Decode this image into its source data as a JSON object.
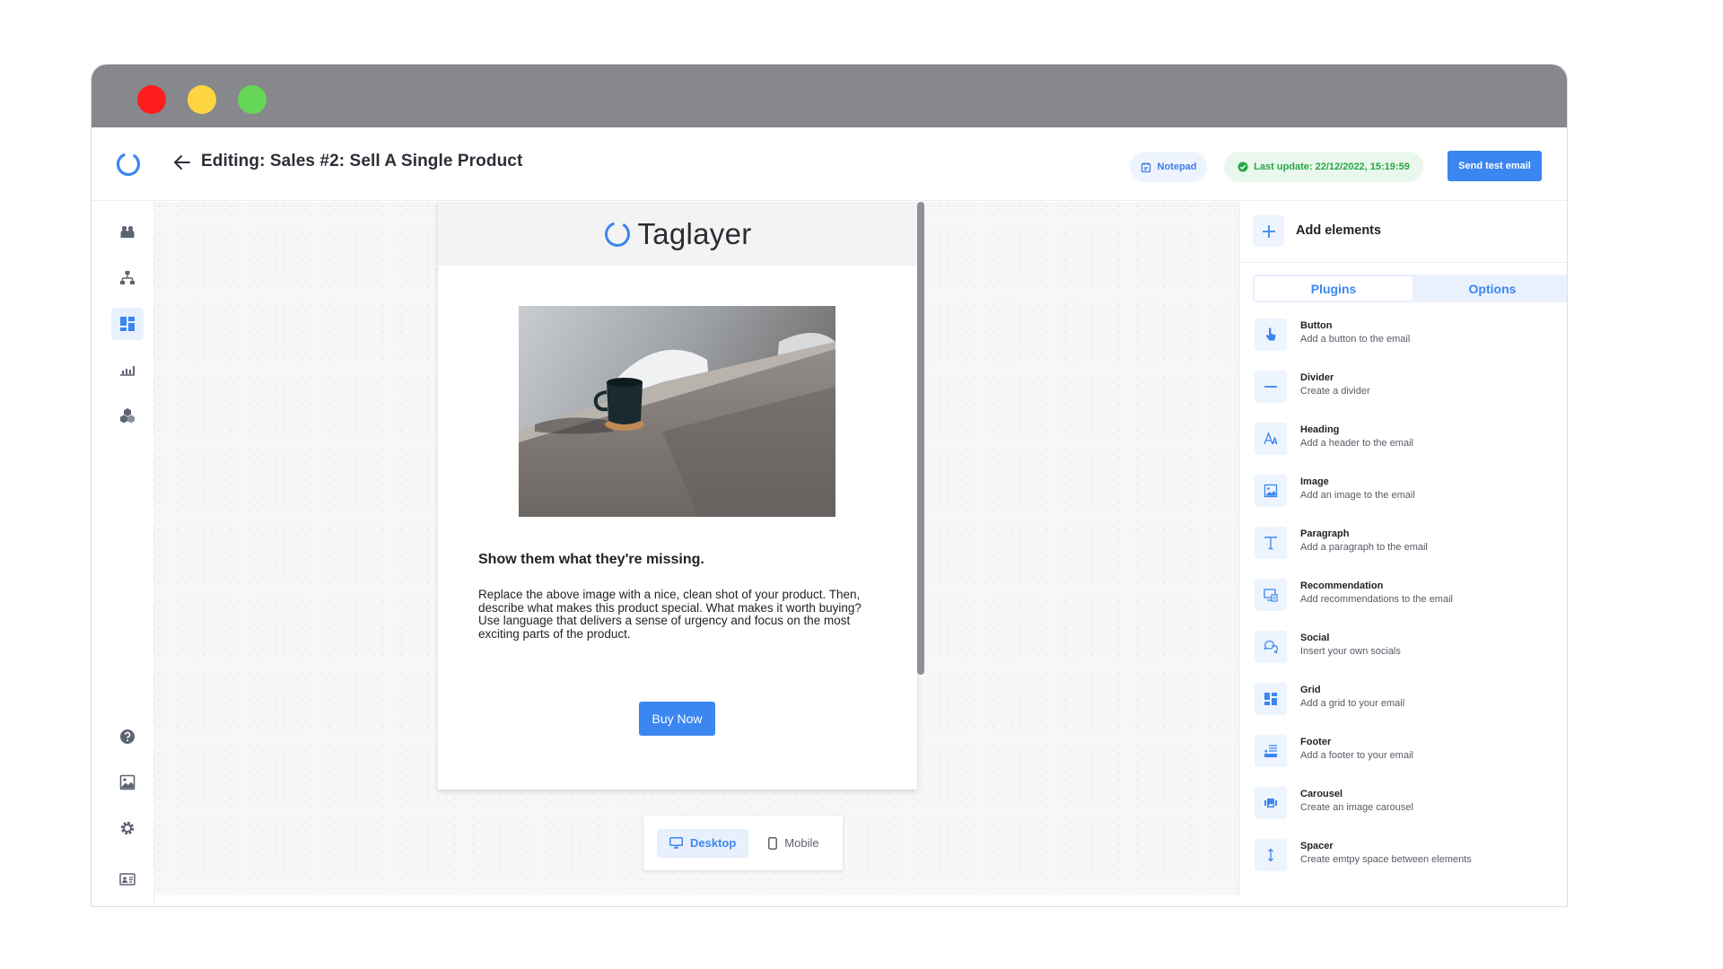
{
  "header": {
    "title": "Editing: Sales #2: Sell A Single Product",
    "notepad_label": "Notepad",
    "last_update_label": "Last update: 22/12/2022, 15:19:59",
    "send_test_label": "Send test email"
  },
  "sidebar": {
    "items": [
      {
        "name": "contacts-icon"
      },
      {
        "name": "segments-icon"
      },
      {
        "name": "templates-icon",
        "active": true
      },
      {
        "name": "analytics-icon"
      },
      {
        "name": "integrations-icon"
      },
      {
        "name": "help-icon"
      },
      {
        "name": "image-library-icon"
      },
      {
        "name": "settings-icon"
      },
      {
        "name": "account-icon"
      }
    ]
  },
  "email": {
    "brand": "Taglayer",
    "heading": "Show them what they're missing.",
    "paragraph": "Replace the above image with a nice, clean shot of your product. Then, describe what makes this product special. What makes it worth buying? Use language that delivers a sense of urgency and focus on the most exciting parts of the product.",
    "cta_label": "Buy Now"
  },
  "device_toggle": {
    "desktop_label": "Desktop",
    "mobile_label": "Mobile",
    "selected": "Desktop"
  },
  "panel": {
    "title": "Add elements",
    "tabs": [
      {
        "label": "Plugins",
        "active": true
      },
      {
        "label": "Options",
        "active": false
      }
    ],
    "plugins": [
      {
        "name": "Button",
        "description": "Add a button to the email",
        "icon": "pointer-icon"
      },
      {
        "name": "Divider",
        "description": "Create a divider",
        "icon": "minus-icon"
      },
      {
        "name": "Heading",
        "description": "Add a header to the email",
        "icon": "heading-icon"
      },
      {
        "name": "Image",
        "description": "Add an image to the email",
        "icon": "image-icon"
      },
      {
        "name": "Paragraph",
        "description": "Add a paragraph to the email",
        "icon": "text-icon"
      },
      {
        "name": "Recommendation",
        "description": "Add recommendations to the email",
        "icon": "recommendation-icon"
      },
      {
        "name": "Social",
        "description": "Insert your own socials",
        "icon": "chat-icon"
      },
      {
        "name": "Grid",
        "description": "Add a grid to your email",
        "icon": "grid-icon"
      },
      {
        "name": "Footer",
        "description": "Add a footer to your email",
        "icon": "footer-icon"
      },
      {
        "name": "Carousel",
        "description": "Create an image carousel",
        "icon": "carousel-icon"
      },
      {
        "name": "Spacer",
        "description": "Create emtpy space between elements",
        "icon": "spacer-icon"
      }
    ]
  },
  "colors": {
    "accent": "#3b86f1",
    "success": "#27a744",
    "titlebar": "#86888c"
  }
}
